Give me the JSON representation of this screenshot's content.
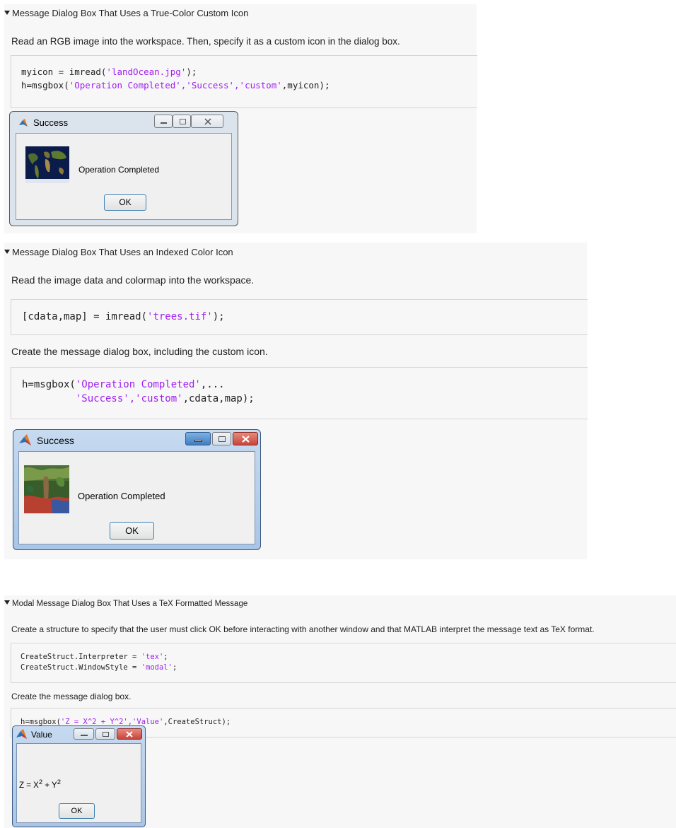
{
  "section1": {
    "heading": "Message Dialog Box That Uses a True-Color Custom Icon",
    "intro": "Read an RGB image into the workspace. Then, specify it as a custom icon in the dialog box.",
    "code": [
      {
        "pre": "myicon = imread(",
        "str": "'landOcean.jpg'",
        "post": ");"
      },
      {
        "pre": "h=msgbox(",
        "str": "'Operation Completed','Success','custom'",
        "post": ",myicon);"
      }
    ],
    "dialog": {
      "title": "Success",
      "message": "Operation Completed",
      "ok": "OK",
      "icon": "world-map-image"
    }
  },
  "section2": {
    "heading": "Message Dialog Box That Uses an Indexed Color Icon",
    "intro": "Read the image data and colormap into the workspace.",
    "code1": {
      "pre": "[cdata,map] = imread(",
      "str": "'trees.tif'",
      "post": ");"
    },
    "intro2": "Create the message dialog box, including the custom icon.",
    "code2": [
      {
        "pre": "h=msgbox(",
        "str": "'Operation Completed'",
        "post": ",..."
      },
      {
        "pre": "         ",
        "str": "'Success','custom'",
        "post": ",cdata,map);"
      }
    ],
    "dialog": {
      "title": "Success",
      "message": "Operation Completed",
      "ok": "OK",
      "icon": "trees-image"
    }
  },
  "section3": {
    "heading": "Modal Message Dialog Box That Uses a TeX Formatted Message",
    "intro": "Create a structure to specify that the user must click OK before interacting with another window and that MATLAB interpret the message text as TeX format.",
    "code1": [
      {
        "pre": "CreateStruct.Interpreter = ",
        "str": "'tex'",
        "post": ";"
      },
      {
        "pre": "CreateStruct.WindowStyle = ",
        "str": "'modal'",
        "post": ";"
      }
    ],
    "intro2": "Create the message dialog box.",
    "code2": {
      "pre": "h=msgbox(",
      "str": "'Z = X^2 + Y^2','Value'",
      "post": ",CreateStruct);"
    },
    "dialog": {
      "title": "Value",
      "message_base1": "Z = X",
      "sup1": "2",
      "message_base2": " + Y",
      "sup2": "2",
      "ok": "OK"
    }
  },
  "colors": {
    "string": "#a020f0",
    "close_red": "#c8453a",
    "accent_blue": "#3c7fb1"
  }
}
